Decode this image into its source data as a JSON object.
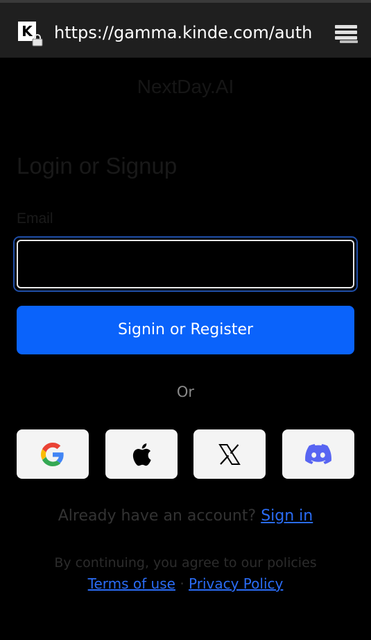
{
  "browser": {
    "site_icon_letter": "K",
    "url": "https://gamma.kinde.com/auth",
    "menu_icon": "tabs-menu-icon"
  },
  "page": {
    "brand": "NextDay.AI",
    "heading": "Login or Signup",
    "email_label": "Email",
    "email_value": "",
    "submit_label": "Signin or Register",
    "or_label": "Or",
    "social_buttons": [
      {
        "name": "Google",
        "icon": "google-icon"
      },
      {
        "name": "Apple",
        "icon": "apple-icon"
      },
      {
        "name": "X",
        "icon": "x-icon"
      },
      {
        "name": "Discord",
        "icon": "discord-icon"
      }
    ],
    "account_prompt": "Already have an account?",
    "sign_in_link": "Sign in",
    "policy_text": "By continuing, you agree to our policies",
    "terms_link": "Terms of use",
    "separator": "·",
    "privacy_link": "Privacy Policy"
  },
  "colors": {
    "background": "#000000",
    "primary": "#0a63fb",
    "link": "#2a6cf5",
    "focus_ring": "#1f4ea8",
    "discord": "#5865f2"
  }
}
